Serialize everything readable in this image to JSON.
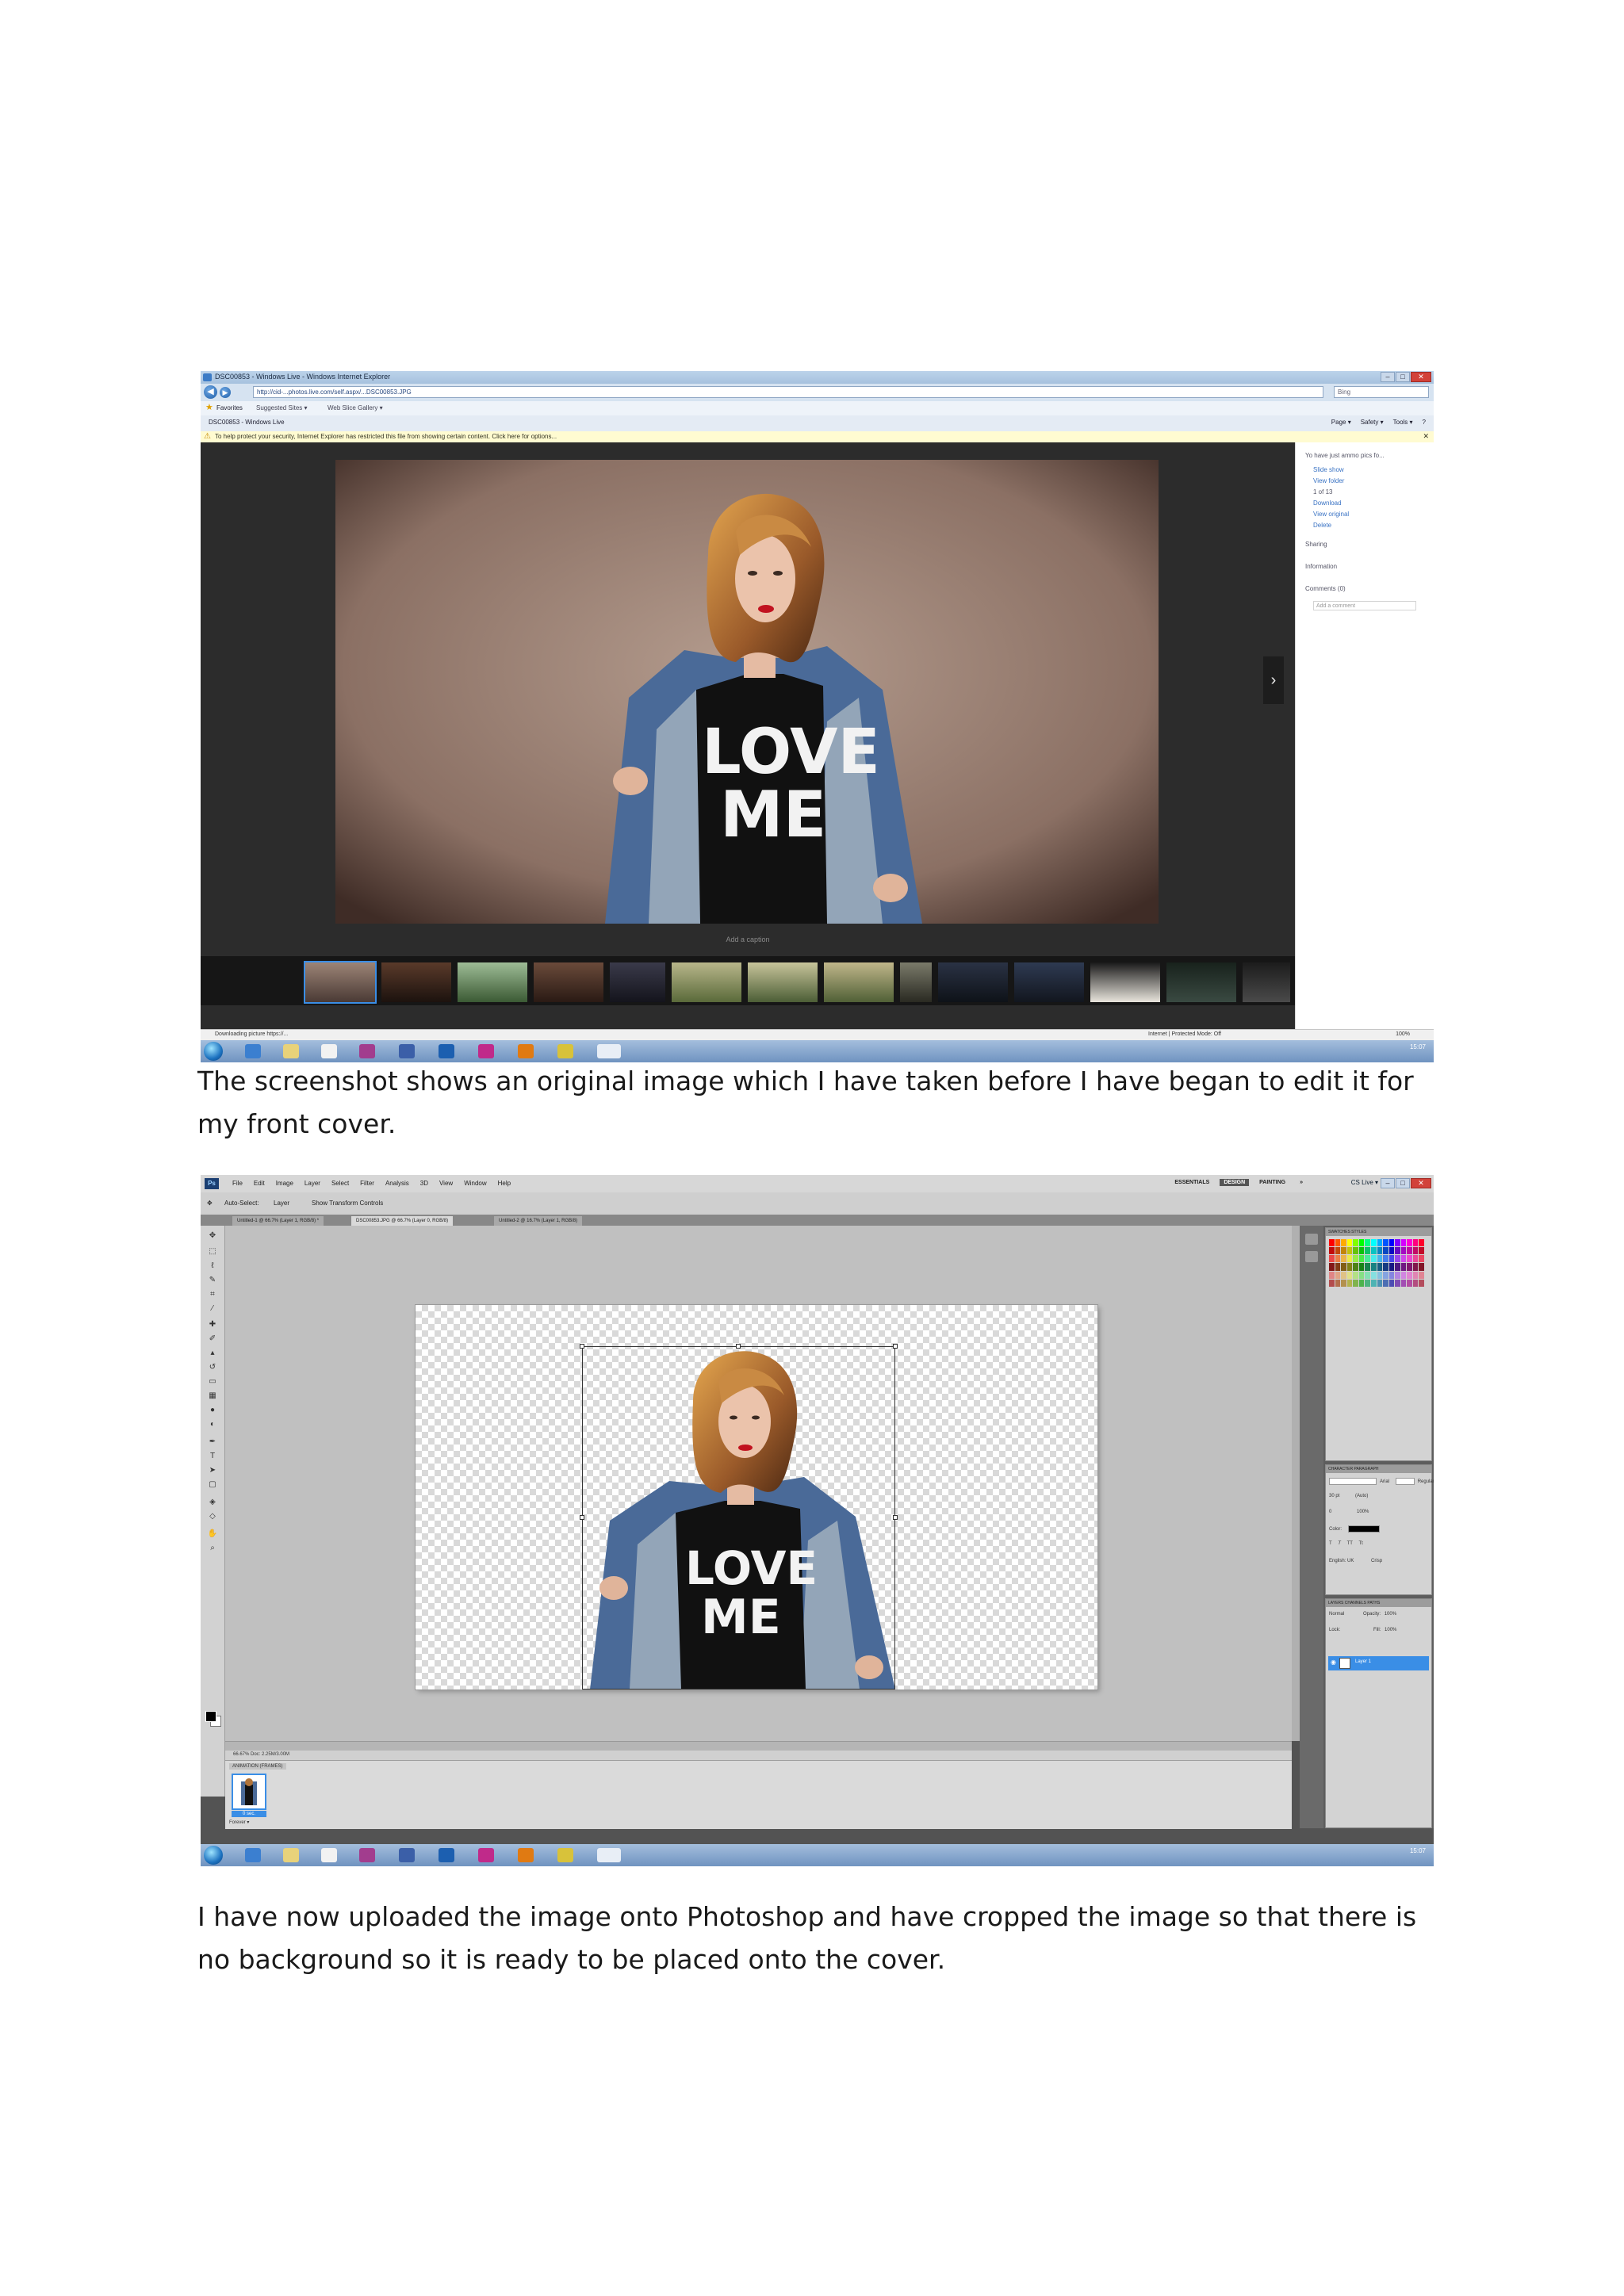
{
  "screenshot1": {
    "window_title": "DSC00853 - Windows Live - Windows Internet Explorer",
    "address_url": "http://cid-...photos.live.com/self.aspx/...DSC00853.JPG",
    "search_placeholder": "Bing",
    "favorites_label": "Favorites",
    "suggested_sites": "Suggested Sites ▾",
    "web_slice": "Web Slice Gallery ▾",
    "tab_title": "DSC00853 - Windows Live",
    "command_items": [
      "Page ▾",
      "Safety ▾",
      "Tools ▾",
      "?"
    ],
    "info_bar": "To help protect your security, Internet Explorer has restricted this file from showing certain content. Click here for options...",
    "caption_placeholder": "Add a caption",
    "side_panel": {
      "added_text": "Yo have just ammo pics fo...",
      "links": [
        "Slide show",
        "View folder",
        "1 of 13",
        "Download",
        "View original",
        "Delete"
      ],
      "sections": [
        "Sharing",
        "Information",
        "Comments (0)"
      ],
      "comment_placeholder": "Add a comment"
    },
    "status_left": "Downloading picture https://...",
    "status_mid": "Internet | Protected Mode: Off",
    "status_zoom": "100%",
    "clock": "15:07"
  },
  "screenshot2": {
    "app_logo": "Ps",
    "menu_items": [
      "File",
      "Edit",
      "Image",
      "Layer",
      "Select",
      "Filter",
      "Analysis",
      "3D",
      "View",
      "Window",
      "Help"
    ],
    "workspaces": [
      "ESSENTIALS",
      "DESIGN",
      "PAINTING",
      "»"
    ],
    "active_workspace": "DESIGN",
    "cs_live": "CS Live ▾",
    "options_bar": [
      "Auto-Select:",
      "Layer",
      "Show Transform Controls"
    ],
    "doc_tabs": [
      "Untitled-1 @ 66.7% (Layer 1, RGB/8) *",
      "DSC00853.JPG @ 66.7% (Layer 0, RGB/8)",
      "Untitled-2 @ 16.7% (Layer 1, RGB/8)"
    ],
    "status_text": "66.67%   Doc: 2.25M/3.00M",
    "animation_tab": "ANIMATION (FRAMES)",
    "frame_time": "0 sec.",
    "loop_option": "Forever ▾",
    "panel_tabs": {
      "swatches": "SWATCHES   STYLES",
      "character": "CHARACTER   PARAGRAPH",
      "layers": "LAYERS   CHANNELS   PATHS"
    },
    "character": {
      "font": "Arial",
      "style": "Regular",
      "size": "30 pt",
      "leading": "(Auto)",
      "tracking": "0",
      "scale": "100%",
      "color_label": "Color:",
      "lang": "English: UK",
      "aa": "Crisp"
    },
    "layers": {
      "blend": "Normal",
      "opacity_label": "Opacity:",
      "opacity": "100%",
      "lock_label": "Lock:",
      "fill_label": "Fill:",
      "fill": "100%",
      "layer_name": "Layer 1"
    },
    "clock": "15:07"
  },
  "paragraphs": {
    "p1": "The screenshot shows an original image which I have taken before I have began to edit it for my front cover.",
    "p2": "I have now uploaded the image onto Photoshop and have cropped the image so that there is no background so it is ready to be placed onto the cover."
  },
  "colors": {
    "taskbar": "#6f93c0",
    "viewer_bg": "#2c2c2c",
    "photo_wall": "#9c8476",
    "ps_canvas_bg": "#c0c0c0",
    "selection_blue": "#3a8ee6"
  },
  "icons": [
    "back-icon",
    "forward-icon",
    "star-icon",
    "warning-icon",
    "next-arrow-icon",
    "start-orb-icon",
    "move-tool-icon",
    "eye-icon"
  ]
}
